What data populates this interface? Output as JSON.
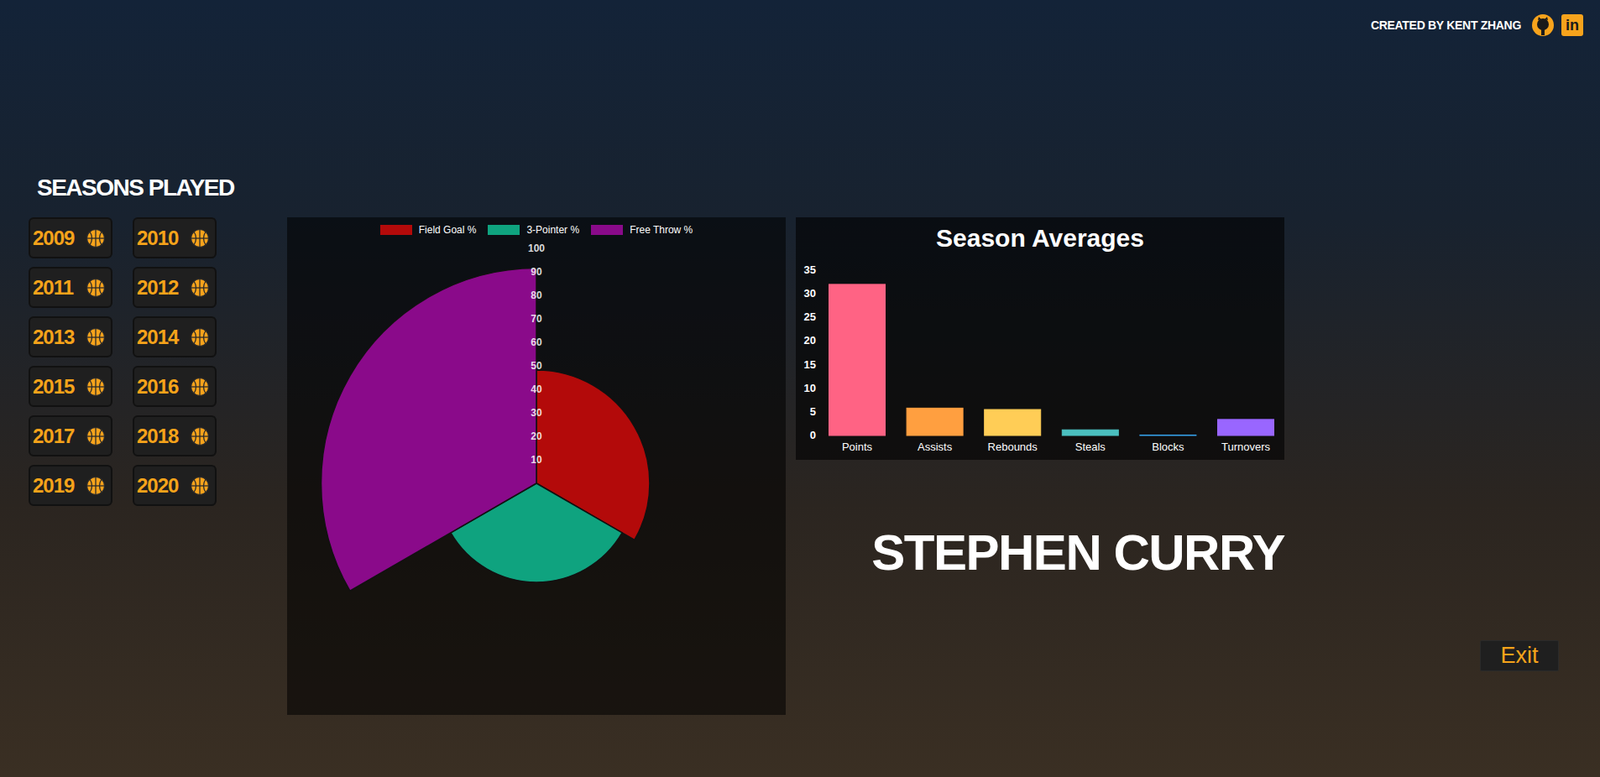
{
  "credits": {
    "text": "CREATED BY KENT ZHANG",
    "linkedin_icon": "in"
  },
  "seasons": {
    "title": "SEASONS PLAYED",
    "items": [
      "2009",
      "2010",
      "2011",
      "2012",
      "2013",
      "2014",
      "2015",
      "2016",
      "2017",
      "2018",
      "2019",
      "2020"
    ]
  },
  "shooting_chart": {
    "ticks": [
      "100",
      "90",
      "80",
      "70",
      "60",
      "50",
      "40",
      "30",
      "20",
      "10"
    ],
    "series": [
      {
        "label": "Field Goal %",
        "color": "#b30a0a",
        "values": [
          48.2
        ]
      },
      {
        "label": "3-Pointer %",
        "color": "#0fa37f",
        "values": [
          42.1
        ]
      },
      {
        "label": "Free Throw %",
        "color": "#8a0a8a",
        "values": [
          91.6
        ]
      }
    ]
  },
  "averages_chart": {
    "title": "Season Averages",
    "ticks": [
      "35",
      "30",
      "25",
      "20",
      "15",
      "10",
      "5",
      "0"
    ],
    "categories": [
      {
        "label": "Points",
        "color": "#ff6384"
      },
      {
        "label": "Assists",
        "color": "#ff9f40"
      },
      {
        "label": "Rebounds",
        "color": "#ffcd56"
      },
      {
        "label": "Steals",
        "color": "#4bc0c0"
      },
      {
        "label": "Blocks",
        "color": "#36a2eb"
      },
      {
        "label": "Turnovers",
        "color": "#9966ff"
      }
    ],
    "values": [
      32.0,
      5.8,
      5.5,
      1.2,
      0.1,
      3.4
    ]
  },
  "player": {
    "name": "STEPHEN CURRY"
  },
  "exit_button": {
    "label": "Exit"
  }
}
